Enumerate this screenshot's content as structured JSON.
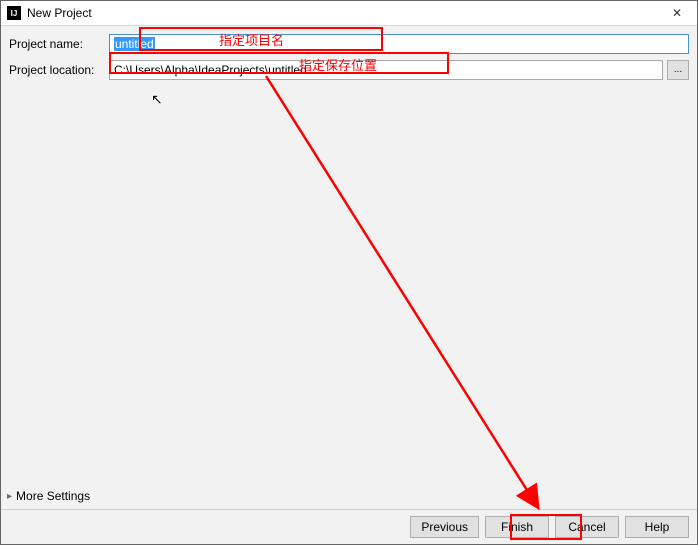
{
  "window": {
    "title": "New Project",
    "app_icon_text": "IJ",
    "close_glyph": "✕"
  },
  "form": {
    "name_label": "Project name:",
    "name_value": "untitled",
    "location_label": "Project location:",
    "location_value": "C:\\Users\\Alpha\\IdeaProjects\\untitled",
    "browse_label": "..."
  },
  "more_settings": {
    "label": "More Settings",
    "tri": "▸"
  },
  "footer": {
    "previous": "Previous",
    "finish": "Finish",
    "cancel": "Cancel",
    "help": "Help"
  },
  "annotations": {
    "label_name": "指定项目名",
    "label_location": "指定保存位置"
  }
}
